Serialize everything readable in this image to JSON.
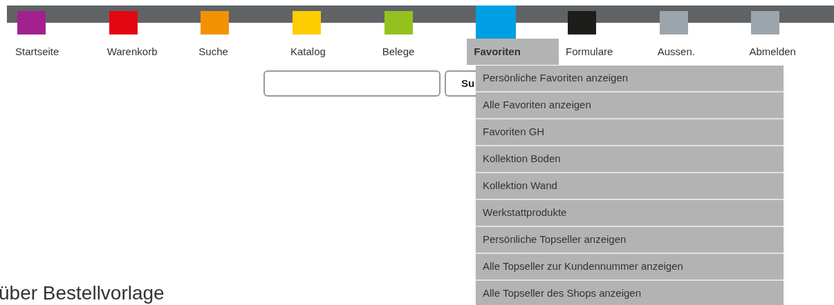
{
  "nav": [
    {
      "label": "Startseite",
      "color": "#a3218e",
      "selected": false
    },
    {
      "label": "Warenkorb",
      "color": "#e30613",
      "selected": false
    },
    {
      "label": "Suche",
      "color": "#f39200",
      "selected": false
    },
    {
      "label": "Katalog",
      "color": "#ffcc00",
      "selected": false
    },
    {
      "label": "Belege",
      "color": "#95c11f",
      "selected": false
    },
    {
      "label": "Favoriten",
      "color": "#009fe3",
      "selected": true
    },
    {
      "label": "Formulare",
      "color": "#1d1d1b",
      "selected": false
    },
    {
      "label": "Aussen.",
      "color": "#9ca5ab",
      "selected": false
    },
    {
      "label": "Abmelden",
      "color": "#9ca5ab",
      "selected": false
    }
  ],
  "dropdown": [
    "Persönliche Favoriten anzeigen",
    "Alle Favoriten anzeigen",
    "Favoriten GH",
    "Kollektion Boden",
    "Kollektion Wand",
    "Werkstattprodukte",
    "Persönliche Topseller anzeigen",
    "Alle Topseller zur Kundennummer anzeigen",
    "Alle Topseller des Shops anzeigen"
  ],
  "search": {
    "button": "Su"
  },
  "heading": "über Bestellvorlage"
}
